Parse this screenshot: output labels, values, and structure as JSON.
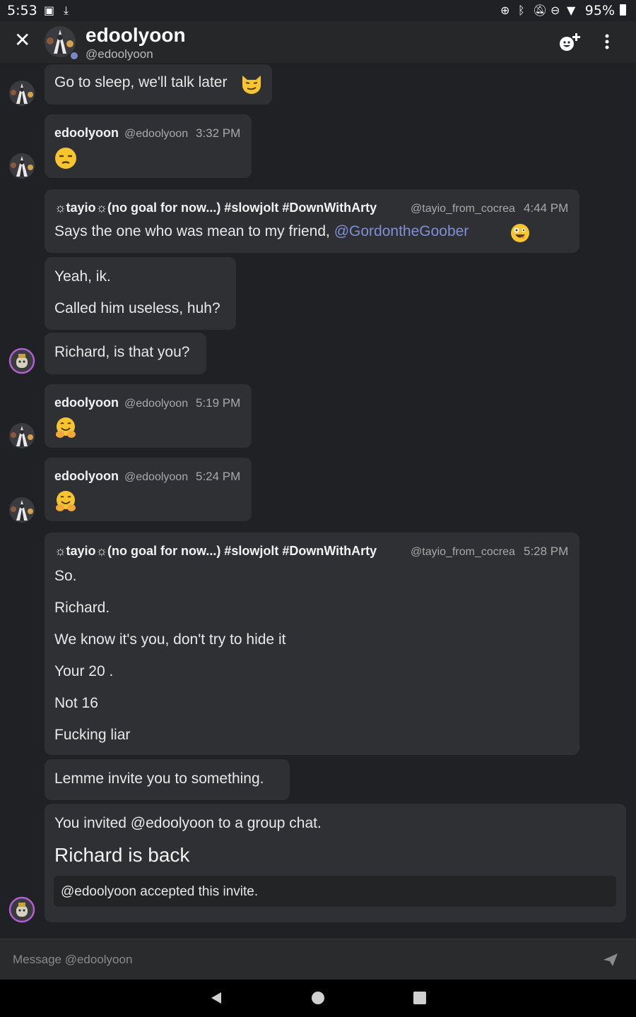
{
  "status_bar": {
    "time": "5:53",
    "battery": "95%",
    "icons": [
      "image-icon",
      "download-icon",
      "sync-icon",
      "bluetooth-icon",
      "mute-icon",
      "dnd-icon",
      "wifi-icon",
      "battery-icon"
    ]
  },
  "header": {
    "title": "edoolyoon",
    "subtitle": "@edoolyoon",
    "close_glyph": "✕"
  },
  "messages": [
    {
      "text": "Go to sleep, we'll talk later"
    },
    {
      "author": "edoolyoon",
      "handle": "@edoolyoon",
      "time": "3:32 PM",
      "emoji": "unamused-face-icon"
    },
    {
      "author": "☼tayio☼(no goal for now...) #slowjolt #DownWithArty",
      "handle": "@tayio_from_cocrea",
      "time": "4:44 PM",
      "text": "Says the one who was mean to my friend, ",
      "mention": "@GordontheGoober"
    },
    {
      "lines": [
        "Yeah, ik.",
        "Called him useless, huh?"
      ]
    },
    {
      "text": "Richard, is that you?"
    },
    {
      "author": "edoolyoon",
      "handle": "@edoolyoon",
      "time": "5:19 PM",
      "emoji": "hugging-face-icon"
    },
    {
      "author": "edoolyoon",
      "handle": "@edoolyoon",
      "time": "5:24 PM",
      "emoji": "hugging-face-icon"
    },
    {
      "author": "☼tayio☼(no goal for now...) #slowjolt #DownWithArty",
      "handle": "@tayio_from_cocrea",
      "time": "5:28 PM",
      "lines": [
        "So.",
        "Richard.",
        "We know it's you, don't try to hide it",
        "Your 20 .",
        "Not 16",
        "Fucking liar"
      ]
    },
    {
      "text": "Lemme invite you to something."
    },
    {
      "text": "You invited @edoolyoon to a group chat.",
      "group_name": "Richard is back",
      "invite_status": "@edoolyoon accepted this invite."
    }
  ],
  "composer": {
    "placeholder": "Message @edoolyoon"
  },
  "colors": {
    "background": "#202124",
    "bubble": "#2f3033",
    "mention": "#7f8fd6",
    "avatar_ring": "#b25fd1"
  }
}
